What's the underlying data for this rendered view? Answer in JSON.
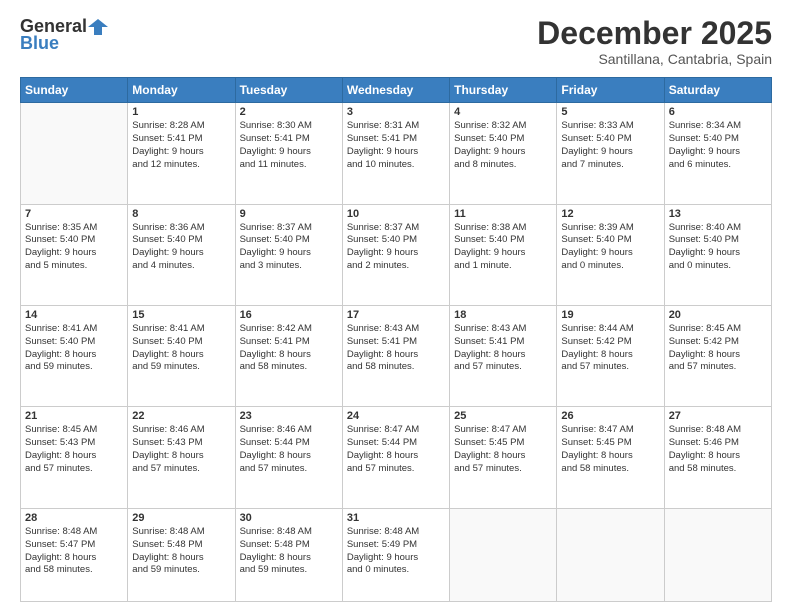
{
  "logo": {
    "general": "General",
    "blue": "Blue"
  },
  "header": {
    "month": "December 2025",
    "location": "Santillana, Cantabria, Spain"
  },
  "weekdays": [
    "Sunday",
    "Monday",
    "Tuesday",
    "Wednesday",
    "Thursday",
    "Friday",
    "Saturday"
  ],
  "weeks": [
    [
      {
        "day": "",
        "info": ""
      },
      {
        "day": "1",
        "info": "Sunrise: 8:28 AM\nSunset: 5:41 PM\nDaylight: 9 hours\nand 12 minutes."
      },
      {
        "day": "2",
        "info": "Sunrise: 8:30 AM\nSunset: 5:41 PM\nDaylight: 9 hours\nand 11 minutes."
      },
      {
        "day": "3",
        "info": "Sunrise: 8:31 AM\nSunset: 5:41 PM\nDaylight: 9 hours\nand 10 minutes."
      },
      {
        "day": "4",
        "info": "Sunrise: 8:32 AM\nSunset: 5:40 PM\nDaylight: 9 hours\nand 8 minutes."
      },
      {
        "day": "5",
        "info": "Sunrise: 8:33 AM\nSunset: 5:40 PM\nDaylight: 9 hours\nand 7 minutes."
      },
      {
        "day": "6",
        "info": "Sunrise: 8:34 AM\nSunset: 5:40 PM\nDaylight: 9 hours\nand 6 minutes."
      }
    ],
    [
      {
        "day": "7",
        "info": "Sunrise: 8:35 AM\nSunset: 5:40 PM\nDaylight: 9 hours\nand 5 minutes."
      },
      {
        "day": "8",
        "info": "Sunrise: 8:36 AM\nSunset: 5:40 PM\nDaylight: 9 hours\nand 4 minutes."
      },
      {
        "day": "9",
        "info": "Sunrise: 8:37 AM\nSunset: 5:40 PM\nDaylight: 9 hours\nand 3 minutes."
      },
      {
        "day": "10",
        "info": "Sunrise: 8:37 AM\nSunset: 5:40 PM\nDaylight: 9 hours\nand 2 minutes."
      },
      {
        "day": "11",
        "info": "Sunrise: 8:38 AM\nSunset: 5:40 PM\nDaylight: 9 hours\nand 1 minute."
      },
      {
        "day": "12",
        "info": "Sunrise: 8:39 AM\nSunset: 5:40 PM\nDaylight: 9 hours\nand 0 minutes."
      },
      {
        "day": "13",
        "info": "Sunrise: 8:40 AM\nSunset: 5:40 PM\nDaylight: 9 hours\nand 0 minutes."
      }
    ],
    [
      {
        "day": "14",
        "info": "Sunrise: 8:41 AM\nSunset: 5:40 PM\nDaylight: 8 hours\nand 59 minutes."
      },
      {
        "day": "15",
        "info": "Sunrise: 8:41 AM\nSunset: 5:40 PM\nDaylight: 8 hours\nand 59 minutes."
      },
      {
        "day": "16",
        "info": "Sunrise: 8:42 AM\nSunset: 5:41 PM\nDaylight: 8 hours\nand 58 minutes."
      },
      {
        "day": "17",
        "info": "Sunrise: 8:43 AM\nSunset: 5:41 PM\nDaylight: 8 hours\nand 58 minutes."
      },
      {
        "day": "18",
        "info": "Sunrise: 8:43 AM\nSunset: 5:41 PM\nDaylight: 8 hours\nand 57 minutes."
      },
      {
        "day": "19",
        "info": "Sunrise: 8:44 AM\nSunset: 5:42 PM\nDaylight: 8 hours\nand 57 minutes."
      },
      {
        "day": "20",
        "info": "Sunrise: 8:45 AM\nSunset: 5:42 PM\nDaylight: 8 hours\nand 57 minutes."
      }
    ],
    [
      {
        "day": "21",
        "info": "Sunrise: 8:45 AM\nSunset: 5:43 PM\nDaylight: 8 hours\nand 57 minutes."
      },
      {
        "day": "22",
        "info": "Sunrise: 8:46 AM\nSunset: 5:43 PM\nDaylight: 8 hours\nand 57 minutes."
      },
      {
        "day": "23",
        "info": "Sunrise: 8:46 AM\nSunset: 5:44 PM\nDaylight: 8 hours\nand 57 minutes."
      },
      {
        "day": "24",
        "info": "Sunrise: 8:47 AM\nSunset: 5:44 PM\nDaylight: 8 hours\nand 57 minutes."
      },
      {
        "day": "25",
        "info": "Sunrise: 8:47 AM\nSunset: 5:45 PM\nDaylight: 8 hours\nand 57 minutes."
      },
      {
        "day": "26",
        "info": "Sunrise: 8:47 AM\nSunset: 5:45 PM\nDaylight: 8 hours\nand 58 minutes."
      },
      {
        "day": "27",
        "info": "Sunrise: 8:48 AM\nSunset: 5:46 PM\nDaylight: 8 hours\nand 58 minutes."
      }
    ],
    [
      {
        "day": "28",
        "info": "Sunrise: 8:48 AM\nSunset: 5:47 PM\nDaylight: 8 hours\nand 58 minutes."
      },
      {
        "day": "29",
        "info": "Sunrise: 8:48 AM\nSunset: 5:48 PM\nDaylight: 8 hours\nand 59 minutes."
      },
      {
        "day": "30",
        "info": "Sunrise: 8:48 AM\nSunset: 5:48 PM\nDaylight: 8 hours\nand 59 minutes."
      },
      {
        "day": "31",
        "info": "Sunrise: 8:48 AM\nSunset: 5:49 PM\nDaylight: 9 hours\nand 0 minutes."
      },
      {
        "day": "",
        "info": ""
      },
      {
        "day": "",
        "info": ""
      },
      {
        "day": "",
        "info": ""
      }
    ]
  ]
}
